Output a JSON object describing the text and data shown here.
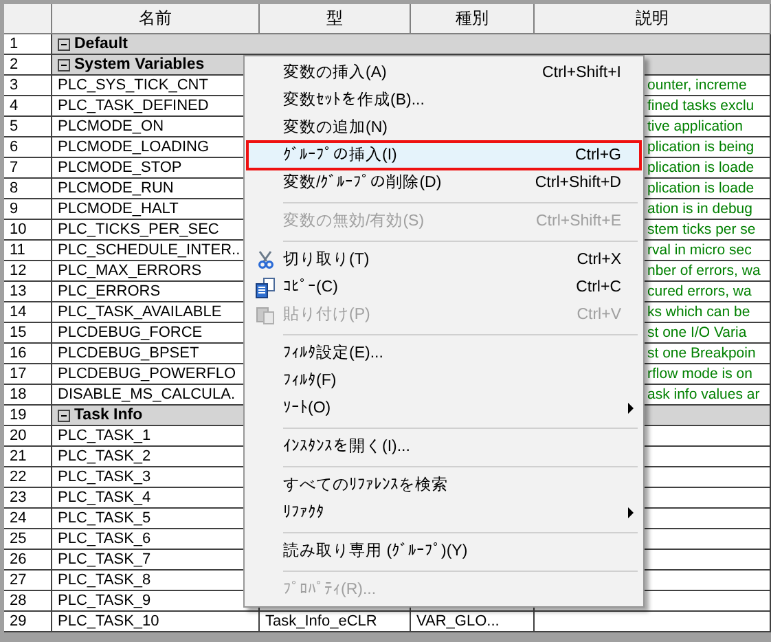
{
  "table": {
    "columns": [
      {
        "label": "名前"
      },
      {
        "label": "型"
      },
      {
        "label": "種別"
      },
      {
        "label": "説明"
      }
    ],
    "rows": [
      {
        "number": "1",
        "kind": "group",
        "name": "Default",
        "expanded": true
      },
      {
        "number": "2",
        "kind": "group",
        "name": "System Variables",
        "expanded": true
      },
      {
        "number": "3",
        "kind": "variable",
        "name": "PLC_SYS_TICK_CNT",
        "description": "ounter, increme"
      },
      {
        "number": "4",
        "kind": "variable",
        "name": "PLC_TASK_DEFINED",
        "description": "fined tasks exclu"
      },
      {
        "number": "5",
        "kind": "variable",
        "name": "PLCMODE_ON",
        "description": "tive application"
      },
      {
        "number": "6",
        "kind": "variable",
        "name": "PLCMODE_LOADING",
        "description": "plication is being"
      },
      {
        "number": "7",
        "kind": "variable",
        "name": "PLCMODE_STOP",
        "description": "plication is loade"
      },
      {
        "number": "8",
        "kind": "variable",
        "name": "PLCMODE_RUN",
        "description": "plication is loade"
      },
      {
        "number": "9",
        "kind": "variable",
        "name": "PLCMODE_HALT",
        "description": "ation is in debug"
      },
      {
        "number": "10",
        "kind": "variable",
        "name": "PLC_TICKS_PER_SEC",
        "description": "stem ticks per se"
      },
      {
        "number": "11",
        "kind": "variable",
        "name": "PLC_SCHEDULE_INTER..",
        "description": "rval in micro sec"
      },
      {
        "number": "12",
        "kind": "variable",
        "name": "PLC_MAX_ERRORS",
        "description": "nber of errors, wa"
      },
      {
        "number": "13",
        "kind": "variable",
        "name": "PLC_ERRORS",
        "description": "cured errors, wa"
      },
      {
        "number": "14",
        "kind": "variable",
        "name": "PLC_TASK_AVAILABLE",
        "description": "ks which can be"
      },
      {
        "number": "15",
        "kind": "variable",
        "name": "PLCDEBUG_FORCE",
        "description": "st one I/O Varia"
      },
      {
        "number": "16",
        "kind": "variable",
        "name": "PLCDEBUG_BPSET",
        "description": "st one Breakpoin"
      },
      {
        "number": "17",
        "kind": "variable",
        "name": "PLCDEBUG_POWERFLO",
        "description": "rflow mode is on"
      },
      {
        "number": "18",
        "kind": "variable",
        "name": "DISABLE_MS_CALCULA.",
        "description": "ask info values ar"
      },
      {
        "number": "19",
        "kind": "group",
        "name": "Task Info",
        "expanded": true
      },
      {
        "number": "20",
        "kind": "variable",
        "name": "PLC_TASK_1"
      },
      {
        "number": "21",
        "kind": "variable",
        "name": "PLC_TASK_2"
      },
      {
        "number": "22",
        "kind": "variable",
        "name": "PLC_TASK_3"
      },
      {
        "number": "23",
        "kind": "variable",
        "name": "PLC_TASK_4"
      },
      {
        "number": "24",
        "kind": "variable",
        "name": "PLC_TASK_5"
      },
      {
        "number": "25",
        "kind": "variable",
        "name": "PLC_TASK_6"
      },
      {
        "number": "26",
        "kind": "variable",
        "name": "PLC_TASK_7"
      },
      {
        "number": "27",
        "kind": "variable",
        "name": "PLC_TASK_8"
      },
      {
        "number": "28",
        "kind": "variable",
        "name": "PLC_TASK_9"
      },
      {
        "number": "29",
        "kind": "variable",
        "name": "PLC_TASK_10",
        "type": "Task_Info_eCLR",
        "class": "VAR_GLO..."
      }
    ]
  },
  "context_menu": {
    "items": [
      {
        "kind": "item",
        "label": "変数の挿入(A)",
        "shortcut": "Ctrl+Shift+I",
        "disabled": false,
        "selected": false,
        "submenu": false
      },
      {
        "kind": "item",
        "label": "変数ｾｯﾄを作成(B)...",
        "disabled": false,
        "selected": false,
        "submenu": false
      },
      {
        "kind": "item",
        "label": "変数の追加(N)",
        "disabled": false,
        "selected": false,
        "submenu": false
      },
      {
        "kind": "item",
        "label": "ｸﾞﾙｰﾌﾟの挿入(I)",
        "shortcut": "Ctrl+G",
        "disabled": false,
        "selected": true,
        "submenu": false
      },
      {
        "kind": "item",
        "label": "変数/ｸﾞﾙｰﾌﾟの削除(D)",
        "shortcut": "Ctrl+Shift+D",
        "disabled": false,
        "selected": false,
        "submenu": false
      },
      {
        "kind": "separator"
      },
      {
        "kind": "item",
        "label": "変数の無効/有効(S)",
        "shortcut": "Ctrl+Shift+E",
        "disabled": true,
        "selected": false,
        "submenu": false
      },
      {
        "kind": "separator"
      },
      {
        "kind": "item",
        "label": "切り取り(T)",
        "shortcut": "Ctrl+X",
        "disabled": false,
        "selected": false,
        "submenu": false
      },
      {
        "kind": "item",
        "label": "ｺﾋﾟｰ(C)",
        "shortcut": "Ctrl+C",
        "disabled": false,
        "selected": false,
        "submenu": false
      },
      {
        "kind": "item",
        "label": "貼り付け(P)",
        "shortcut": "Ctrl+V",
        "disabled": true,
        "selected": false,
        "submenu": false
      },
      {
        "kind": "separator"
      },
      {
        "kind": "item",
        "label": "ﾌｨﾙﾀ設定(E)...",
        "disabled": false,
        "selected": false,
        "submenu": false
      },
      {
        "kind": "item",
        "label": "ﾌｨﾙﾀ(F)",
        "disabled": false,
        "selected": false,
        "submenu": false
      },
      {
        "kind": "item",
        "label": "ｿｰﾄ(O)",
        "disabled": false,
        "selected": false,
        "submenu": true
      },
      {
        "kind": "separator"
      },
      {
        "kind": "item",
        "label": "ｲﾝｽﾀﾝｽを開く(I)...",
        "disabled": false,
        "selected": false,
        "submenu": false
      },
      {
        "kind": "separator"
      },
      {
        "kind": "item",
        "label": "すべてのﾘﾌｧﾚﾝｽを検索",
        "disabled": false,
        "selected": false,
        "submenu": false
      },
      {
        "kind": "item",
        "label": "ﾘﾌｧｸﾀ",
        "disabled": false,
        "selected": false,
        "submenu": true
      },
      {
        "kind": "separator"
      },
      {
        "kind": "item",
        "label": "読み取り専用 (ｸﾞﾙｰﾌﾟ)(Y)",
        "disabled": false,
        "selected": false,
        "submenu": false
      },
      {
        "kind": "separator"
      },
      {
        "kind": "item",
        "label": "ﾌﾟﾛﾊﾟﾃｨ(R)...",
        "disabled": true,
        "selected": false,
        "submenu": false
      }
    ]
  }
}
